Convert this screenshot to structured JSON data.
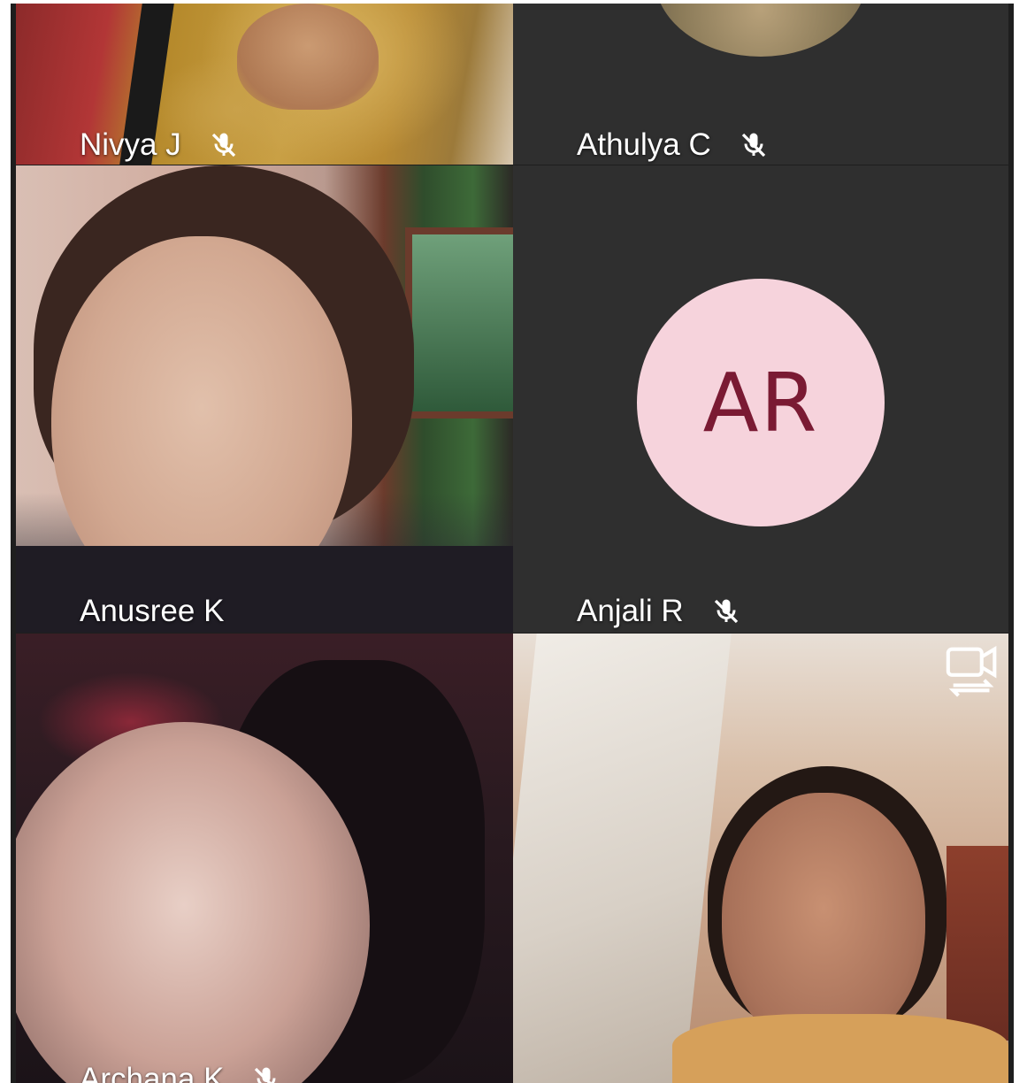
{
  "participants": [
    {
      "name": "Nivya J",
      "mic": "mic-off-icon"
    },
    {
      "name": "Athulya C",
      "mic": "mic-off-icon"
    },
    {
      "name": "Anusree K",
      "mic": "none"
    },
    {
      "name": "Anjali R",
      "mic": "mic-off-icon",
      "avatar_initials": "AR",
      "avatar_color": "#f6d3dc",
      "avatar_text_color": "#7a1a33"
    },
    {
      "name": "Archana K",
      "mic": "mic-off-icon"
    },
    {
      "name": "",
      "mic": "none"
    }
  ],
  "controls": {
    "switch_camera_icon": "switch-camera-icon"
  }
}
